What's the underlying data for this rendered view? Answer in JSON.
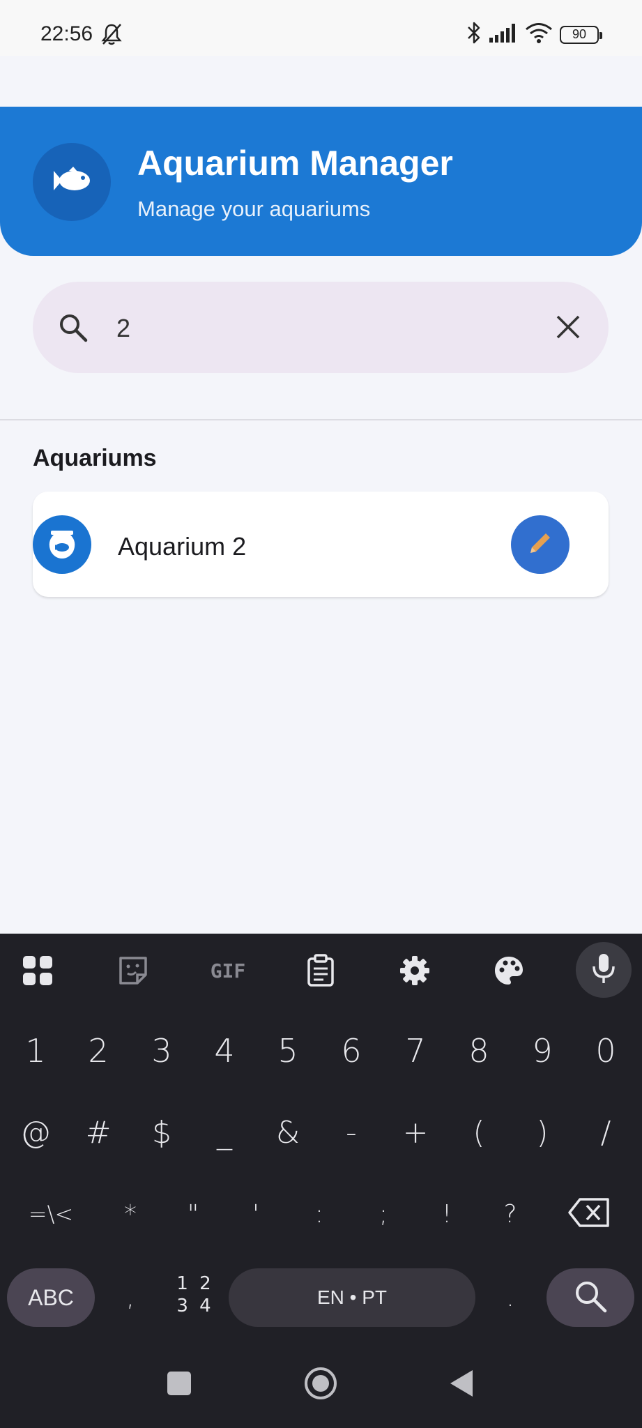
{
  "status_bar": {
    "time": "22:56",
    "battery": "90",
    "icons": [
      "bell-off-icon",
      "bluetooth-icon",
      "signal-icon",
      "wifi-icon",
      "battery-icon"
    ]
  },
  "header": {
    "title": "Aquarium Manager",
    "subtitle": "Manage your aquariums",
    "icon": "fish-icon",
    "color": "#1c79d4"
  },
  "search": {
    "value": "2",
    "icon": "search-icon",
    "clear_icon": "close-icon"
  },
  "section": {
    "title": "Aquariums"
  },
  "list": {
    "items": [
      {
        "label": "Aquarium 2",
        "icon": "fishbowl-icon",
        "action_icon": "pencil-icon"
      }
    ]
  },
  "keyboard": {
    "toolbar": [
      "apps-icon",
      "sticker-icon",
      "gif-icon",
      "clipboard-icon",
      "settings-icon",
      "palette-icon",
      "mic-icon"
    ],
    "gif_label": "GIF",
    "row1": [
      "1",
      "2",
      "3",
      "4",
      "5",
      "6",
      "7",
      "8",
      "9",
      "0"
    ],
    "row2": [
      "@",
      "#",
      "$",
      "_",
      "&",
      "-",
      "+",
      "(",
      ")",
      "/"
    ],
    "row3": [
      "=\\<",
      "*",
      "\"",
      "'",
      ":",
      ";",
      "!",
      "?"
    ],
    "row4": {
      "abc": "ABC",
      "comma": ",",
      "numpad_top": "1 2",
      "numpad_bottom": "3 4",
      "space": "EN • PT",
      "period": "."
    }
  },
  "nav_bar": {
    "icons": [
      "recents-icon",
      "home-icon",
      "back-icon"
    ]
  }
}
